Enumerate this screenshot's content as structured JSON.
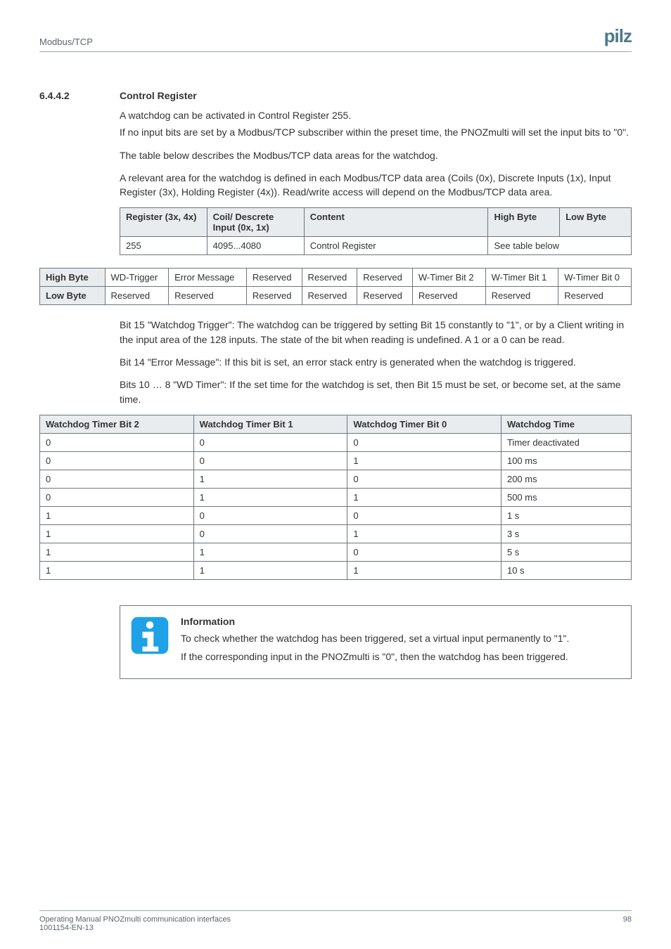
{
  "header": {
    "section": "Modbus/TCP",
    "brand": "pilz"
  },
  "heading": {
    "number": "6.4.4.2",
    "title": "Control Register"
  },
  "paragraphs": {
    "p1a": "A watchdog can be activated in Control Register 255.",
    "p1b": "If no input bits are set by a Modbus/TCP subscriber within the preset time, the PNOZmulti will set the input bits to \"0\".",
    "p2": "The table below describes the Modbus/TCP data areas for the watchdog.",
    "p3": "A relevant area for the watchdog is defined in each Modbus/TCP data area (Coils (0x), Discrete Inputs (1x), Input Register (3x), Holding Register (4x)). Read/write access will depend on the Modbus/TCP data area."
  },
  "table1": {
    "headers": {
      "register": "Register (3x, 4x)",
      "coil": "Coil/ Descrete Input (0x, 1x)",
      "content": "Content",
      "high": "High Byte",
      "low": "Low Byte"
    },
    "row": {
      "register": "255",
      "coil": "4095...4080",
      "content": "Control Register",
      "span": "See table below"
    }
  },
  "table2": {
    "row_hb_label": "High Byte",
    "row_lb_label": "Low Byte",
    "hb": [
      "WD-Trigger",
      "Error Message",
      "Reserved",
      "Reserved",
      "Reserved",
      "W-Timer Bit 2",
      "W-Timer Bit 1",
      "W-Timer Bit 0"
    ],
    "lb": [
      "Reserved",
      "Reserved",
      "Reserved",
      "Reserved",
      "Reserved",
      "Reserved",
      "Reserved",
      "Reserved"
    ]
  },
  "bits": {
    "b15": "Bit 15 \"Watchdog Trigger\": The watchdog can be triggered by setting Bit 15 constantly to \"1\", or by a Client writing in the input area of the 128 inputs. The state of the bit when reading is undefined. A 1 or a 0 can be read.",
    "b14": "Bit 14 \"Error Message\": If this bit is set, an error stack entry is generated when the watchdog is triggered.",
    "b108": "Bits 10 … 8 \"WD Timer\": If the set time for the watchdog is set, then Bit 15 must be set, or become set, at the same time."
  },
  "table3": {
    "headers": [
      "Watchdog Timer Bit 2",
      "Watchdog Timer Bit 1",
      "Watchdog Timer Bit 0",
      "Watchdog Time"
    ],
    "rows": [
      [
        "0",
        "0",
        "0",
        "Timer deactivated"
      ],
      [
        "0",
        "0",
        "1",
        "100 ms"
      ],
      [
        "0",
        "1",
        "0",
        "200 ms"
      ],
      [
        "0",
        "1",
        "1",
        "500 ms"
      ],
      [
        "1",
        "0",
        "0",
        "1 s"
      ],
      [
        "1",
        "0",
        "1",
        "3 s"
      ],
      [
        "1",
        "1",
        "0",
        "5 s"
      ],
      [
        "1",
        "1",
        "1",
        "10 s"
      ]
    ]
  },
  "info": {
    "title": "Information",
    "line1": "To check whether the watchdog has been triggered, set a virtual input permanently to \"1\".",
    "line2": "If the corresponding input in the PNOZmulti is \"0\", then the watchdog has been triggered."
  },
  "footer": {
    "left1": "Operating Manual PNOZmulti communication interfaces",
    "left2": "1001154-EN-13",
    "page": "98"
  }
}
